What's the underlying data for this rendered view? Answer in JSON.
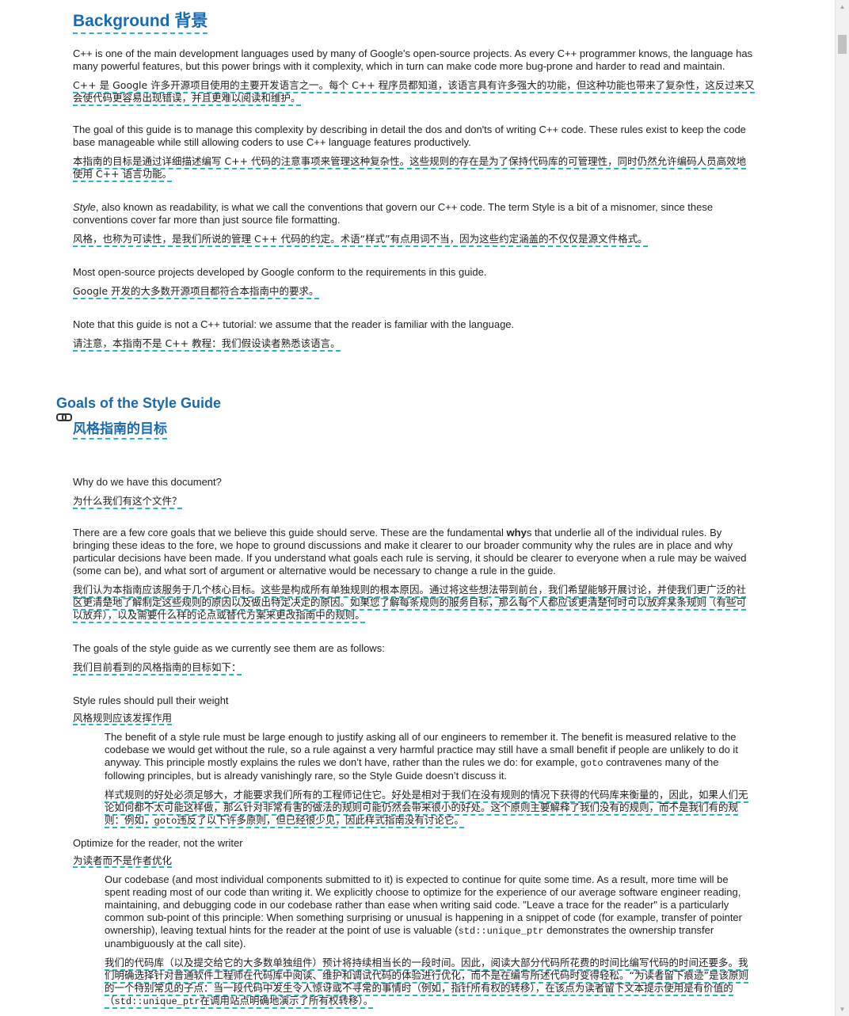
{
  "background": {
    "title_en": "Background",
    "title_zh": "背景",
    "paras": [
      {
        "en": "C++ is one of the main development languages used by many of Google's open-source projects. As every C++ programmer knows, the language has many powerful features, but this power brings with it complexity, which in turn can make code more bug-prone and harder to read and maintain.",
        "zh": "C++ 是 Google 许多开源项目使用的主要开发语言之一。每个 C++ 程序员都知道，该语言具有许多强大的功能，但这种功能也带来了复杂性，这反过来又会使代码更容易出现错误，并且更难以阅读和维护。"
      },
      {
        "en": "The goal of this guide is to manage this complexity by describing in detail the dos and don'ts of writing C++ code. These rules exist to keep the code base manageable while still allowing coders to use C++ language features productively.",
        "zh": "本指南的目标是通过详细描述编写 C++ 代码的注意事项来管理这种复杂性。这些规则的存在是为了保持代码库的可管理性，同时仍然允许编码人员高效地使用 C++ 语言功能。"
      },
      {
        "en_em": "Style",
        "en": ", also known as readability, is what we call the conventions that govern our C++ code. The term Style is a bit of a misnomer, since these conventions cover far more than just source file formatting.",
        "zh": "风格，也称为可读性，是我们所说的管理 C++ 代码的约定。术语“样式”有点用词不当，因为这些约定涵盖的不仅仅是源文件格式。"
      },
      {
        "en": "Most open-source projects developed by Google conform to the requirements in this guide.",
        "zh": "Google 开发的大多数开源项目都符合本指南中的要求。"
      },
      {
        "en": "Note that this guide is not a C++ tutorial: we assume that the reader is familiar with the language.",
        "zh": "请注意，本指南不是 C++ 教程：我们假设读者熟悉该语言。"
      }
    ]
  },
  "goals": {
    "title_en": "Goals of the Style Guide",
    "title_zh": "风格指南的目标",
    "link_icon": "link-icon",
    "why_en": "Why do we have this document?",
    "why_zh": "为什么我们有这个文件？",
    "core_en_1": "There are a few core goals that we believe this guide should serve. These are the fundamental ",
    "core_en_bold": "why",
    "core_en_2": "s that underlie all of the individual rules. By bringing these ideas to the fore, we hope to ground discussions and make it clearer to our broader community why the rules are in place and why particular decisions have been made. If you understand what goals each rule is serving, it should be clearer to everyone when a rule may be waived (some can be), and what sort of argument or alternative would be necessary to change a rule in the guide.",
    "core_zh": "我们认为本指南应该服务于几个核心目标。这些是构成所有单独规则的根本原因。通过将这些想法带到前台，我们希望能够开展讨论，并使我们更广泛的社区更清楚地了解制定这些规则的原因以及做出特定决定的原因。如果您了解每条规则的服务目标，那么每个人都应该更清楚何时可以放弃某条规则（有些可以放弃），以及需要什么样的论点或替代方案来更改指南中的规则。",
    "current_en": "The goals of the style guide as we currently see them are as follows:",
    "current_zh": "我们目前看到的风格指南的目标如下：",
    "items": [
      {
        "term_en": "Style rules should pull their weight",
        "term_zh": "风格规则应该发挥作用",
        "desc_en_1": "The benefit of a style rule must be large enough to justify asking all of our engineers to remember it. The benefit is measured relative to the codebase we would get without the rule, so a rule against a very harmful practice may still have a small benefit if people are unlikely to do it anyway. This principle mostly explains the rules we don’t have, rather than the rules we do: for example, ",
        "desc_en_code": "goto",
        "desc_en_2": " contravenes many of the following principles, but is already vanishingly rare, so the Style Guide doesn’t discuss it.",
        "desc_zh_1": "样式规则的好处必须足够大，才能要求我们所有的工程师记住它。好处是相对于我们在没有规则的情况下获得的代码库来衡量的，因此，如果人们无论如何都不太可能这样做，那么针对非常有害的做法的规则可能仍然会带来很小的好处。这个原则主要解释了我们没有的规则，而不是我们有的规则：例如，",
        "desc_zh_code": "goto",
        "desc_zh_2": "违反了以下许多原则，但已经很少见，因此样式指南没有讨论它。"
      },
      {
        "term_en": "Optimize for the reader, not the writer",
        "term_zh": "为读者而不是作者优化",
        "desc_en_1": "Our codebase (and most individual components submitted to it) is expected to continue for quite some time. As a result, more time will be spent reading most of our code than writing it. We explicitly choose to optimize for the experience of our average software engineer reading, maintaining, and debugging code in our codebase rather than ease when writing said code. \"Leave a trace for the reader\" is a particularly common sub-point of this principle: When something surprising or unusual is happening in a snippet of code (for example, transfer of pointer ownership), leaving textual hints for the reader at the point of use is valuable (",
        "desc_en_code": "std::unique_ptr",
        "desc_en_2": " demonstrates the ownership transfer unambiguously at the call site).",
        "desc_zh_1": "我们的代码库（以及提交给它的大多数单独组件）预计将持续相当长的一段时间。因此，阅读大部分代码所花费的时间比编写代码的时间还要多。我们明确选择针对普通软件工程师在代码库中阅读、维护和调试代码的体验进行优化，而不是在编写所述代码时变得轻松。“为读者留下痕迹”是该原则的一个特别常见的子点：当一段代码中发生令人惊讶或不寻常的事情时（例如，指针所有权的转移），在该点为读者留下文本提示使用是有价值的（",
        "desc_zh_code": "std::unique_ptr",
        "desc_zh_2": "在调用站点明确地演示了所有权转移）。"
      }
    ]
  }
}
